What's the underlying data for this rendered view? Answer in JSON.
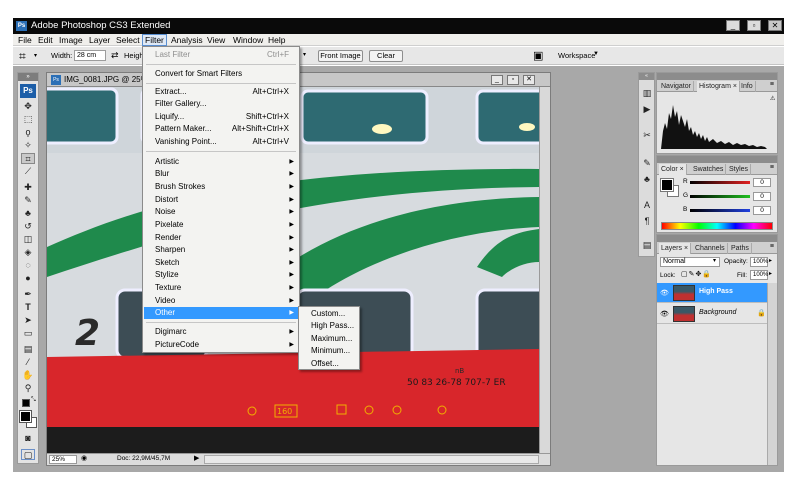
{
  "app": {
    "window_title": "Adobe Photoshop CS3 Extended",
    "logo_text": "Ps"
  },
  "menubar": {
    "items": [
      "File",
      "Edit",
      "Image",
      "Layer",
      "Select",
      "Filter",
      "Analysis",
      "View",
      "Window",
      "Help"
    ],
    "active": "Filter"
  },
  "options_bar": {
    "width_label": "Width:",
    "width_value": "28 cm",
    "height_label": "Heigh",
    "front_image_label": "Front Image",
    "clear_label": "Clear",
    "workspace_label": "Workspace"
  },
  "document": {
    "title": "IMG_0081.JPG @ 25%",
    "zoom": "25%",
    "doc_size": "Doc: 22,9M/45,7M",
    "train_text": {
      "number": "2",
      "code_small": "nB",
      "code_line": "50 83  26-78 707-7  ER",
      "marking": "160"
    }
  },
  "filter_menu": {
    "last_filter": {
      "label": "Last Filter",
      "shortcut": "Ctrl+F"
    },
    "convert": "Convert for Smart Filters",
    "group1": [
      {
        "label": "Extract...",
        "shortcut": "Alt+Ctrl+X"
      },
      {
        "label": "Filter Gallery...",
        "shortcut": ""
      },
      {
        "label": "Liquify...",
        "shortcut": "Shift+Ctrl+X"
      },
      {
        "label": "Pattern Maker...",
        "shortcut": "Alt+Shift+Ctrl+X"
      },
      {
        "label": "Vanishing Point...",
        "shortcut": "Alt+Ctrl+V"
      }
    ],
    "group2": [
      "Artistic",
      "Blur",
      "Brush Strokes",
      "Distort",
      "Noise",
      "Pixelate",
      "Render",
      "Sharpen",
      "Sketch",
      "Stylize",
      "Texture",
      "Video",
      "Other"
    ],
    "group3": [
      "Digimarc",
      "PictureCode"
    ],
    "highlighted": "Other"
  },
  "other_submenu": {
    "items": [
      "Custom...",
      "High Pass...",
      "Maximum...",
      "Minimum...",
      "Offset..."
    ]
  },
  "panels": {
    "navigator_group": {
      "tabs": [
        "Navigator",
        "Histogram",
        "Info"
      ],
      "active": "Histogram"
    },
    "color_group": {
      "tabs": [
        "Color",
        "Swatches",
        "Styles"
      ],
      "active": "Color",
      "channels": [
        {
          "label": "R",
          "value": "0",
          "color": "#e02020"
        },
        {
          "label": "G",
          "value": "0",
          "color": "#20c020"
        },
        {
          "label": "B",
          "value": "0",
          "color": "#2040e0"
        }
      ]
    },
    "layers_group": {
      "tabs": [
        "Layers",
        "Channels",
        "Paths"
      ],
      "active": "Layers",
      "blend_mode": "Normal",
      "opacity_label": "Opacity:",
      "opacity_value": "100%",
      "lock_label": "Lock:",
      "fill_label": "Fill:",
      "fill_value": "100%",
      "layers": [
        {
          "name": "High Pass",
          "selected": true
        },
        {
          "name": "Background",
          "selected": false
        }
      ]
    }
  },
  "colors": {
    "menu_highlight": "#3399ff",
    "titlebar": "#0a0a0a",
    "workspace": "#a8a8a8"
  }
}
